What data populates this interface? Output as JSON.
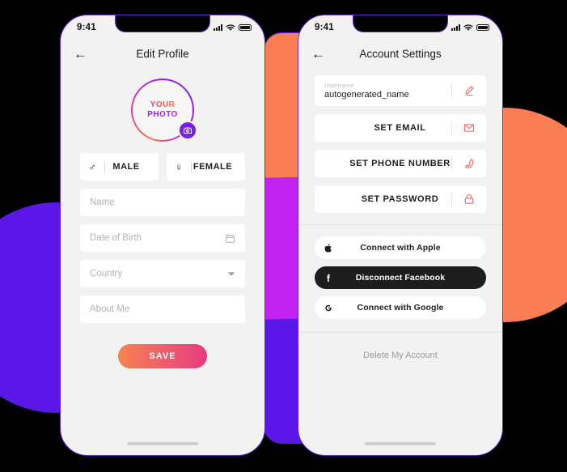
{
  "colors": {
    "accent_purple": "#7B1FE8",
    "accent_orange": "#FA7E54",
    "accent_magenta": "#C321F0",
    "icon_red": "#F56A6A",
    "save_gradient_start": "#F5834F",
    "save_gradient_end": "#E73B80",
    "dark_pill": "#1D1D1D",
    "screen_bg": "#F2F2F3"
  },
  "statusbar": {
    "time": "9:41",
    "signal_icon": "signal-bars-icon",
    "wifi_icon": "wifi-icon",
    "battery_icon": "battery-icon"
  },
  "left_phone": {
    "nav": {
      "back_icon": "back-arrow-icon",
      "title": "Edit Profile"
    },
    "avatar": {
      "line1": "YOUR",
      "line2": "PHOTO",
      "camera_badge_icon": "camera-icon"
    },
    "gender": [
      {
        "symbol": "♂",
        "label": "MALE",
        "icon_name": "male-symbol-icon"
      },
      {
        "symbol": "♀",
        "label": "FEMALE",
        "icon_name": "female-symbol-icon"
      }
    ],
    "fields": [
      {
        "placeholder": "Name",
        "value": "",
        "tail_icon": ""
      },
      {
        "placeholder": "Date of Birth",
        "value": "",
        "tail_icon": "calendar-icon"
      },
      {
        "placeholder": "Country",
        "value": "",
        "tail_icon": "chevron-down-icon"
      },
      {
        "placeholder": "About Me",
        "value": "",
        "tail_icon": ""
      }
    ],
    "save_label": "SAVE"
  },
  "right_phone": {
    "nav": {
      "back_icon": "back-arrow-icon",
      "title": "Account Settings"
    },
    "username": {
      "label": "Username",
      "value": "autogenerated_name",
      "edit_icon": "pencil-edit-icon"
    },
    "actions": [
      {
        "label": "SET EMAIL",
        "icon_name": "envelope-icon"
      },
      {
        "label": "SET PHONE NUMBER",
        "icon_name": "phone-icon"
      },
      {
        "label": "SET PASSWORD",
        "icon_name": "lock-icon"
      }
    ],
    "social": [
      {
        "label": "Connect with Apple",
        "icon_name": "apple-logo-icon",
        "style": "light"
      },
      {
        "label": "Disconnect Facebook",
        "icon_name": "facebook-logo-icon",
        "style": "dark"
      },
      {
        "label": "Connect with Google",
        "icon_name": "google-logo-icon",
        "style": "light"
      }
    ],
    "delete_label": "Delete My Account"
  }
}
